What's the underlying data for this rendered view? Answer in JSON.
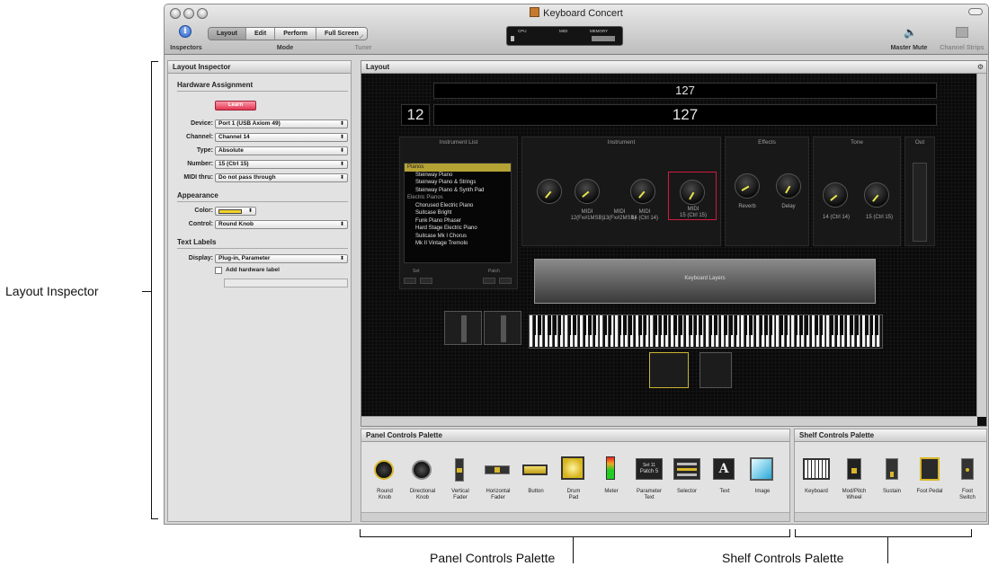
{
  "window": {
    "title": "Keyboard Concert"
  },
  "toolbar": {
    "inspectors_label": "Inspectors",
    "mode_label": "Mode",
    "mode_buttons": [
      "Layout",
      "Edit",
      "Perform",
      "Full Screen"
    ],
    "selected_mode": "Layout",
    "tuner_label": "Tuner",
    "lcd": {
      "cpu": "CPU",
      "midi": "MIDI",
      "memory": "MEMORY"
    },
    "master_mute_label": "Master Mute",
    "channel_strips_label": "Channel Strips"
  },
  "inspector": {
    "title": "Layout Inspector",
    "hardware": {
      "heading": "Hardware Assignment",
      "learn_label": "Learn",
      "fields": [
        {
          "label": "Device:",
          "value": "Port 1 (USB Axiom 49)"
        },
        {
          "label": "Channel:",
          "value": "Channel 14"
        },
        {
          "label": "Type:",
          "value": "Absolute"
        },
        {
          "label": "Number:",
          "value": "15 (Ctrl 15)"
        },
        {
          "label": "MIDI thru:",
          "value": "Do not pass through"
        }
      ]
    },
    "appearance": {
      "heading": "Appearance",
      "color_label": "Color:",
      "color_value": "#f2d32a",
      "control_label": "Control:",
      "control_value": "Round Knob"
    },
    "text_labels": {
      "heading": "Text Labels",
      "display_label": "Display:",
      "display_value": "Plug-in, Parameter",
      "add_label": "Add hardware label"
    }
  },
  "layout": {
    "title": "Layout",
    "display_top": "127",
    "display_left": "12",
    "display_right": "127",
    "sections": {
      "instrument_list": "Instrument List",
      "instrument": "Instrument",
      "effects": "Effects",
      "tone": "Tone",
      "out": "Out"
    },
    "instrument_list": [
      {
        "text": "Pianos",
        "type": "header",
        "selected": true
      },
      {
        "text": "Steinway Piano",
        "type": "item"
      },
      {
        "text": "Steinway Piano & Strings",
        "type": "item"
      },
      {
        "text": "Steinway Piano & Synth Pad",
        "type": "item"
      },
      {
        "text": "Electric Pianos",
        "type": "header"
      },
      {
        "text": "Chorused Electric Piano",
        "type": "item"
      },
      {
        "text": "Suitcase Bright",
        "type": "item"
      },
      {
        "text": "Funk Piano Phaser",
        "type": "item"
      },
      {
        "text": "Hard Stage Electric Piano",
        "type": "item"
      },
      {
        "text": "Suitcase Mk I Chorus",
        "type": "item"
      },
      {
        "text": "Mk II Vintage Tremolo",
        "type": "item"
      }
    ],
    "set_label": "Set",
    "patch_label": "Patch",
    "instrument_knobs": [
      {
        "line1": "",
        "line2": ""
      },
      {
        "line1": "MIDI",
        "line2": "12(Fx#1MSB)"
      },
      {
        "line1": "MIDI",
        "line2": "13(Fx#2MSB)"
      },
      {
        "line1": "MIDI",
        "line2": "14 (Ctrl 14)"
      },
      {
        "line1": "MIDI",
        "line2": "15 (Ctrl 15)"
      }
    ],
    "effects_knobs": [
      "Reverb",
      "Delay"
    ],
    "tone_knobs": [
      "14 (Ctrl 14)",
      "15 (Ctrl 15)"
    ],
    "keyboard_layers_label": "Keyboard Layers"
  },
  "panel_palette": {
    "title": "Panel Controls Palette",
    "items": [
      {
        "line1": "Round",
        "line2": "Knob",
        "icon": "round-knob-icon"
      },
      {
        "line1": "Directional",
        "line2": "Knob",
        "icon": "directional-knob-icon"
      },
      {
        "line1": "Vertical",
        "line2": "Fader",
        "icon": "vertical-fader-icon"
      },
      {
        "line1": "Horizontal",
        "line2": "Fader",
        "icon": "horizontal-fader-icon"
      },
      {
        "line1": "Button",
        "line2": "",
        "icon": "button-icon"
      },
      {
        "line1": "Drum",
        "line2": "Pad",
        "icon": "drum-pad-icon"
      },
      {
        "line1": "Meter",
        "line2": "",
        "icon": "meter-icon"
      },
      {
        "line1": "Parameter",
        "line2": "Text",
        "icon": "parameter-text-icon"
      },
      {
        "line1": "Selector",
        "line2": "",
        "icon": "selector-icon"
      },
      {
        "line1": "Text",
        "line2": "",
        "icon": "text-icon"
      },
      {
        "line1": "Image",
        "line2": "",
        "icon": "image-icon"
      }
    ],
    "param_set": "Set 11",
    "param_patch": "Patch 5",
    "text_glyph": "A"
  },
  "shelf_palette": {
    "title": "Shelf Controls Palette",
    "items": [
      {
        "line1": "Keyboard",
        "line2": "",
        "icon": "keyboard-icon"
      },
      {
        "line1": "Mod/Pitch",
        "line2": "Wheel",
        "icon": "mod-pitch-wheel-icon"
      },
      {
        "line1": "Sustain",
        "line2": "",
        "icon": "sustain-icon"
      },
      {
        "line1": "Foot Pedal",
        "line2": "",
        "icon": "foot-pedal-icon"
      },
      {
        "line1": "Foot",
        "line2": "Switch",
        "icon": "foot-switch-icon"
      }
    ]
  },
  "annotations": {
    "left": "Layout Inspector",
    "bottom_left": "Panel Controls Palette",
    "bottom_right": "Shelf Controls Palette"
  }
}
